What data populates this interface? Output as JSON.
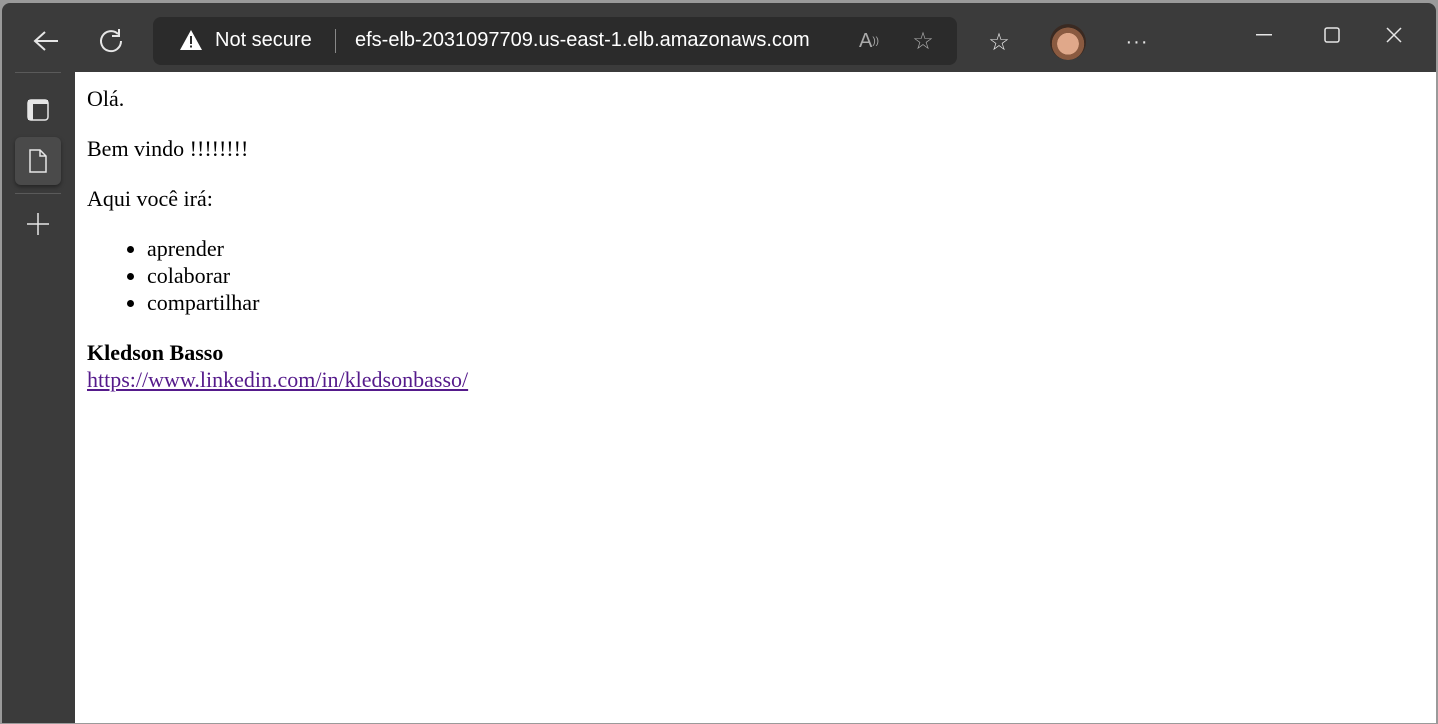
{
  "browser": {
    "security_label": "Not secure",
    "url": "efs-elb-2031097709.us-east-1.elb.amazonaws.com",
    "toolbar_icons": [
      "back-icon",
      "refresh-icon",
      "read-aloud-icon",
      "add-favorite-icon",
      "favorites-icon",
      "profile-avatar",
      "more-icon",
      "minimize-icon",
      "maximize-icon",
      "close-icon"
    ],
    "sidebar_icons": [
      "tab-actions-icon",
      "page-tab-icon",
      "new-tab-icon"
    ]
  },
  "page": {
    "greeting": "Olá.",
    "welcome": "Bem vindo !!!!!!!!",
    "intro": "Aqui você irá:",
    "items": [
      "aprender",
      "colaborar",
      "compartilhar"
    ],
    "author": "Kledson Basso",
    "link": "https://www.linkedin.com/in/kledsonbasso/"
  },
  "colors": {
    "chrome": "#3b3b3b",
    "address_bar": "#2b2b2b",
    "visited_link": "#551a8b"
  }
}
